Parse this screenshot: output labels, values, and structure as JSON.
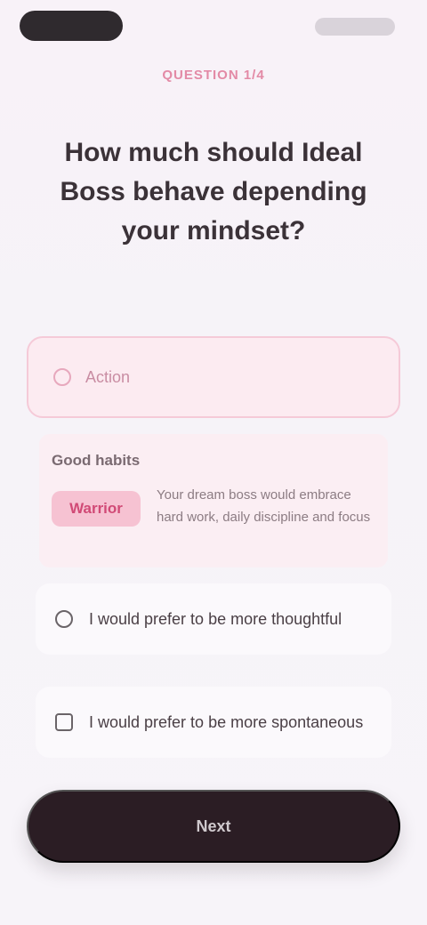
{
  "header": {
    "step_label": "QUESTION 1/4",
    "title": "How much should Ideal Boss behave depending your mindset?"
  },
  "selected_option": {
    "label": "Action"
  },
  "info": {
    "title": "Good habits",
    "badge": "Warrior",
    "description": "Your dream boss would embrace hard work, daily discipline and focus"
  },
  "options": [
    {
      "label": "I would prefer to be more thoughtful"
    },
    {
      "label": "I would prefer to be more spontaneous"
    }
  ],
  "cta": {
    "label": "Next"
  }
}
